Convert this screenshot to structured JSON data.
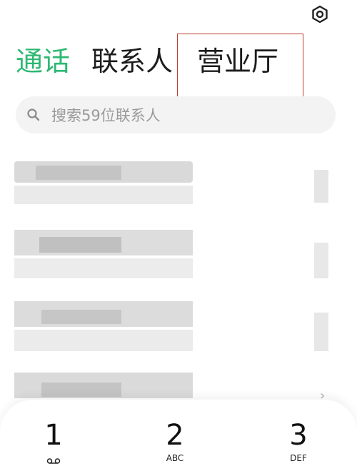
{
  "header": {
    "settings_icon": "gear-icon"
  },
  "tabs": [
    {
      "label": "通话",
      "active": true,
      "color": "#2eb872"
    },
    {
      "label": "联系人",
      "active": false
    },
    {
      "label": "营业厅",
      "active": false,
      "highlighted": true
    }
  ],
  "search": {
    "icon": "search-icon",
    "placeholder": "搜索59位联系人"
  },
  "contacts": {
    "note": "",
    "row_arrow": "›"
  },
  "keypad": {
    "keys": [
      {
        "digit": "1",
        "letters": "",
        "icon": "voicemail-icon"
      },
      {
        "digit": "2",
        "letters": "ABC"
      },
      {
        "digit": "3",
        "letters": "DEF"
      }
    ]
  },
  "colors": {
    "accent": "#2eb872",
    "highlight_border": "#c0392b"
  }
}
